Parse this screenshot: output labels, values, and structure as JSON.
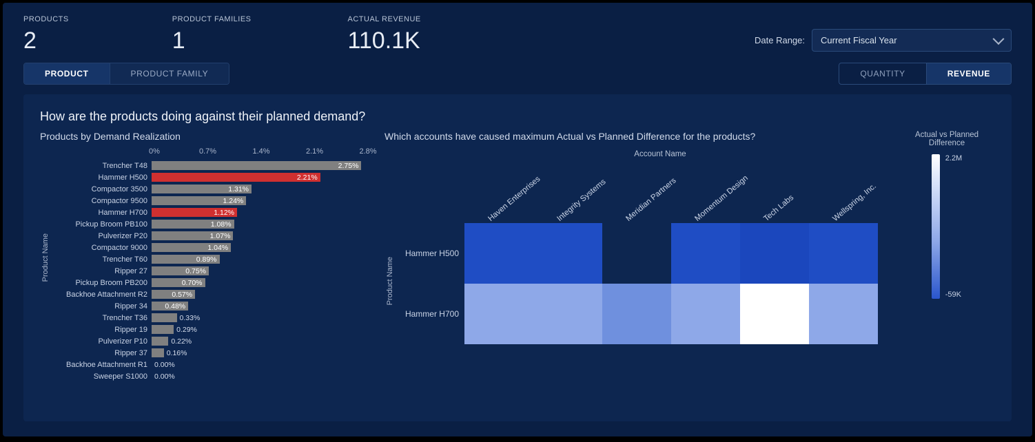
{
  "header": {
    "products_label": "PRODUCTS",
    "products_value": "2",
    "families_label": "PRODUCT FAMILIES",
    "families_value": "1",
    "revenue_label": "ACTUAL REVENUE",
    "revenue_value": "110.1K",
    "date_range_label": "Date Range:",
    "date_range_value": "Current Fiscal Year"
  },
  "tabs": {
    "left": [
      {
        "label": "PRODUCT",
        "active": true
      },
      {
        "label": "PRODUCT FAMILY",
        "active": false
      }
    ],
    "right": [
      {
        "label": "QUANTITY",
        "active": false
      },
      {
        "label": "REVENUE",
        "active": true
      }
    ]
  },
  "panel": {
    "title": "How are the products doing against their planned demand?",
    "bar_subtitle": "Products by Demand Realization",
    "heatmap_subtitle": "Which accounts have caused maximum Actual vs Planned Difference for the products?",
    "bar_ylabel": "Product Name",
    "heatmap_xlabel": "Account Name",
    "heatmap_ylabel": "Product Name",
    "legend_title": "Actual vs Planned Difference",
    "legend_max": "2.2M",
    "legend_min": "-59K"
  },
  "chart_data": [
    {
      "type": "bar",
      "title": "Products by Demand Realization",
      "xlabel": "",
      "ylabel": "Product Name",
      "xlim": [
        0,
        2.8
      ],
      "x_ticks": [
        "0%",
        "0.7%",
        "1.4%",
        "2.1%",
        "2.8%"
      ],
      "categories": [
        "Trencher T48",
        "Hammer H500",
        "Compactor 3500",
        "Compactor 9500",
        "Hammer H700",
        "Pickup Broom PB100",
        "Pulverizer P20",
        "Compactor 9000",
        "Trencher T60",
        "Ripper 27",
        "Pickup Broom PB200",
        "Backhoe Attachment R2",
        "Ripper 34",
        "Trencher T36",
        "Ripper 19",
        "Pulverizer P10",
        "Ripper 37",
        "Backhoe Attachment R1",
        "Sweeper S1000"
      ],
      "values": [
        2.75,
        2.21,
        1.31,
        1.24,
        1.12,
        1.08,
        1.07,
        1.04,
        0.89,
        0.75,
        0.7,
        0.57,
        0.48,
        0.33,
        0.29,
        0.22,
        0.16,
        0.0,
        0.0
      ],
      "value_labels": [
        "2.75%",
        "2.21%",
        "1.31%",
        "1.24%",
        "1.12%",
        "1.08%",
        "1.07%",
        "1.04%",
        "0.89%",
        "0.75%",
        "0.70%",
        "0.57%",
        "0.48%",
        "0.33%",
        "0.29%",
        "0.22%",
        "0.16%",
        "0.00%",
        "0.00%"
      ],
      "highlight": [
        "Hammer H500",
        "Hammer H700"
      ]
    },
    {
      "type": "heatmap",
      "title": "Which accounts have caused maximum Actual vs Planned Difference for the products?",
      "xlabel": "Account Name",
      "ylabel": "Product Name",
      "x_categories": [
        "Haven Enterprises",
        "Integrity Systems",
        "Meridian Partners",
        "Momentum Design",
        "Tech Labs",
        "Wellspring, Inc."
      ],
      "y_categories": [
        "Hammer H500",
        "Hammer H700"
      ],
      "color_scale": {
        "min": -59000,
        "max": 2200000,
        "min_label": "-59K",
        "max_label": "2.2M"
      },
      "cells": [
        [
          "#1f4dc4",
          "#1f4dc4",
          "#0d2650",
          "#1f4dc4",
          "#1b47bd",
          "#1f4dc4"
        ],
        [
          "#8ea8e8",
          "#8ea8e8",
          "#6f90de",
          "#8ea8e8",
          "#ffffff",
          "#8ea8e8"
        ]
      ]
    }
  ]
}
